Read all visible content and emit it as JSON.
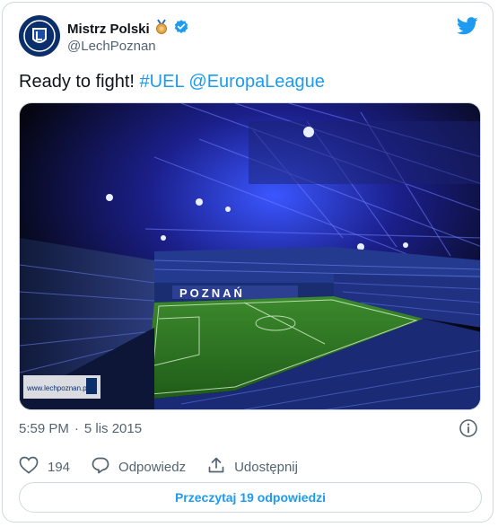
{
  "tweet": {
    "author_name": "Mistrz Polski",
    "author_handle": "@LechPoznan",
    "text_plain": "Ready to fight! ",
    "hashtag": "#UEL",
    "mention": "@EuropaLeague",
    "time": "5:59 PM",
    "separator": "·",
    "date": "5 lis 2015",
    "likes": "194",
    "reply_label": "Odpowiedz",
    "share_label": "Udostępnij",
    "read_replies_label": "Przeczytaj 19 odpowiedzi",
    "media": {
      "stadium_sign": "POZNAŃ",
      "watermark": "www.lechpoznan.pl"
    }
  },
  "colors": {
    "accent": "#1d9bf0",
    "muted": "#536471",
    "border": "#cfd9de",
    "verified": "#1d9bf0",
    "badge": "#e0a84b"
  },
  "icons": [
    "lech-logo-icon",
    "medal-icon",
    "verified-icon",
    "twitter-bird-icon",
    "info-icon",
    "heart-icon",
    "reply-icon",
    "share-icon"
  ]
}
